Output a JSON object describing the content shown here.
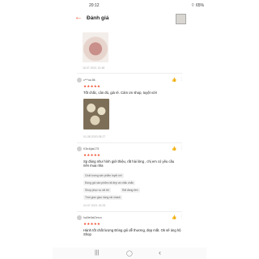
{
  "status_bar": {
    "time": "20:12",
    "battery": "65%"
  },
  "app_bar": {
    "back_icon": "arrow-left-icon",
    "title": "Đánh giá"
  },
  "reviews": [
    {
      "date": "16.07.2021 12:48"
    },
    {
      "username": "c***ua 86",
      "rating": 5,
      "stars": "★★★★★",
      "comment": "Tốt chắc, cân đủ, giá rẻ. Cảm ơn shop, tuyệt vời!",
      "date": "01.08.2020 05:27"
    },
    {
      "username": "K3n4ijak175",
      "rating": 5,
      "stars": "★★★★★",
      "comment": "Sp đúng như hình giới thiệu, rất hài lòng , chị em có yêu cầu nên mua nha",
      "tags": [
        "Chất lượng sản phẩm tuyệt vời",
        "Đóng gói sản phẩm rất đẹp và chắc chắn",
        "Shop phục vụ rất tốt",
        "Rất đáng tiền",
        "Thời gian giao hàng rất nhanh"
      ],
      "date": "24.07.2021 15:25"
    },
    {
      "username": "ha0ie0aiGerco",
      "rating": 5,
      "stars": "★★★★★",
      "comment": "Hành tốt chất lượng Đóng gói dễ thương, đẹp mắt. Ok sẽ ủng hộ Shop"
    }
  ],
  "nav_bar": {
    "recent": "|||",
    "home": "◯",
    "back": "‹"
  },
  "colors": {
    "accent": "#ee4d2d",
    "tag_bg": "#f2f2f2",
    "text": "#222222"
  }
}
